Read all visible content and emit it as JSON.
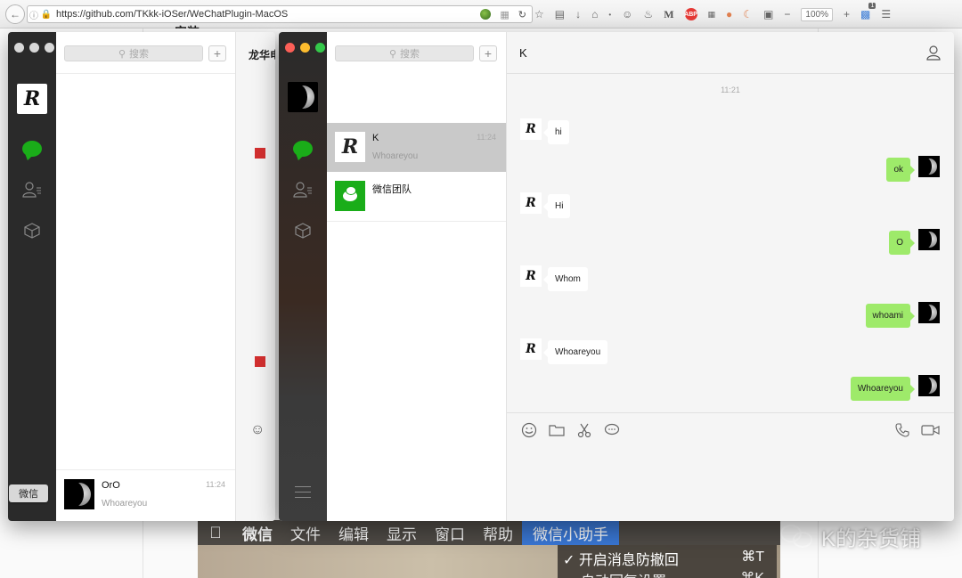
{
  "browser": {
    "url": "https://github.com/TKkk-iOSer/WeChatPlugin-MacOS",
    "zoom": "100%",
    "badge_count": "1"
  },
  "web_page": {
    "partial_heading": "安装"
  },
  "mac_menubar": {
    "items": [
      "微信",
      "文件",
      "编辑",
      "显示",
      "窗口",
      "帮助",
      "微信小助手"
    ],
    "dropdown": [
      {
        "label": "✓ 开启消息防撤回",
        "shortcut": "⌘T"
      },
      {
        "label": "自动回复设置",
        "shortcut": "⌘K"
      }
    ]
  },
  "watermark": {
    "text": "K的杂货铺"
  },
  "back_window": {
    "search_placeholder": "搜索",
    "chat_title": "龙华电",
    "tag": "微信",
    "chats": [
      {
        "name": "OrO",
        "subtitle": "Whoareyou",
        "time": "11:24"
      }
    ]
  },
  "front_window": {
    "search_placeholder": "搜索",
    "chats": [
      {
        "name": "K",
        "subtitle": "Whoareyou",
        "time": "11:24",
        "selected": true
      },
      {
        "name": "微信团队",
        "subtitle": "",
        "time": ""
      }
    ],
    "conversation": {
      "title": "K",
      "timestamp": "11:21",
      "messages": [
        {
          "dir": "in",
          "text": "hi"
        },
        {
          "dir": "out",
          "text": "ok"
        },
        {
          "dir": "in",
          "text": "Hi"
        },
        {
          "dir": "out",
          "text": "O"
        },
        {
          "dir": "in",
          "text": "Whom"
        },
        {
          "dir": "out",
          "text": "whoami"
        },
        {
          "dir": "in",
          "text": "Whoareyou"
        },
        {
          "dir": "out",
          "text": "Whoareyou"
        }
      ]
    },
    "colors": {
      "incoming_bubble": "#ffffff",
      "outgoing_bubble": "#9eea6a",
      "brand_green": "#1aad19"
    }
  }
}
